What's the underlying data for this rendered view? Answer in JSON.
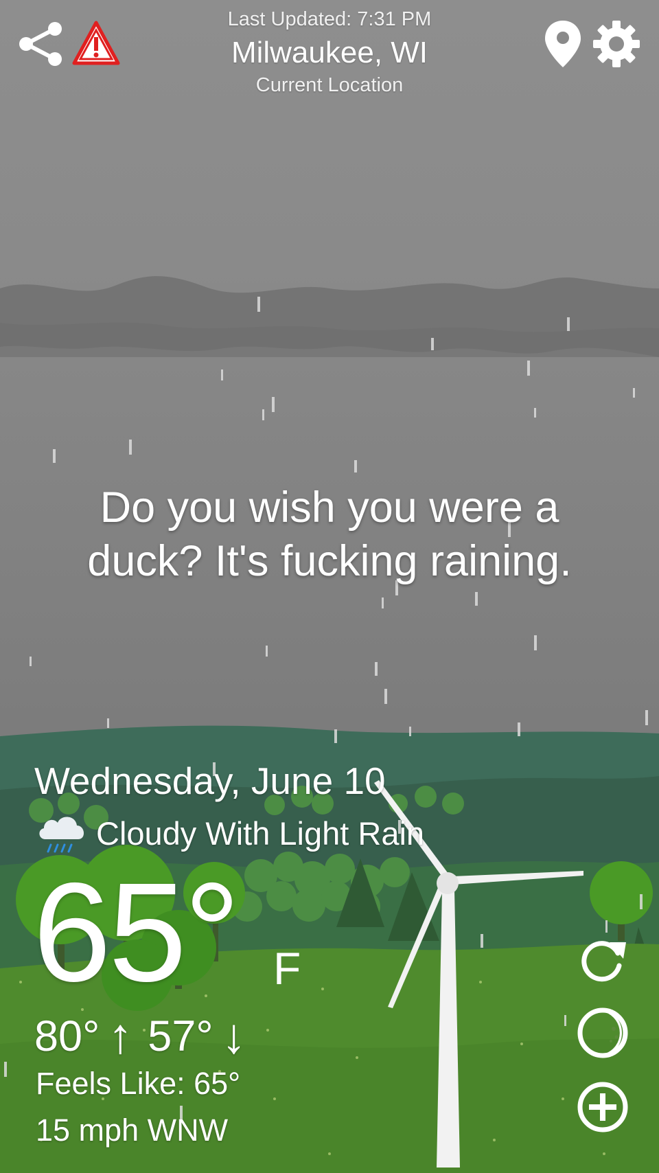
{
  "header": {
    "last_updated": "Last Updated: 7:31 PM",
    "city": "Milwaukee, WI",
    "location_type": "Current Location"
  },
  "message": "Do you wish you were a duck? It's fucking raining.",
  "weather": {
    "date": "Wednesday, June 10",
    "condition": "Cloudy With Light Rain",
    "condition_icon": "cloud-rain-icon",
    "temperature": "65°",
    "unit": "F",
    "high": "80°",
    "low": "57°",
    "feels_like": "Feels Like: 65°",
    "wind": "15 mph WNW"
  },
  "colors": {
    "sky": "#8a8a8a",
    "cloud_band": "#727272",
    "far_hills": "#3f6d5b",
    "meadow": "#4f8a2f",
    "tree": "#4b9a2a",
    "alert_red": "#e02020"
  },
  "actions": {
    "share_icon": "share-icon",
    "alert_icon": "alert-icon",
    "location_icon": "location-pin-icon",
    "settings_icon": "gear-icon",
    "refresh_icon": "refresh-icon",
    "theme_icon": "moon-theme-icon",
    "add_icon": "add-icon"
  }
}
